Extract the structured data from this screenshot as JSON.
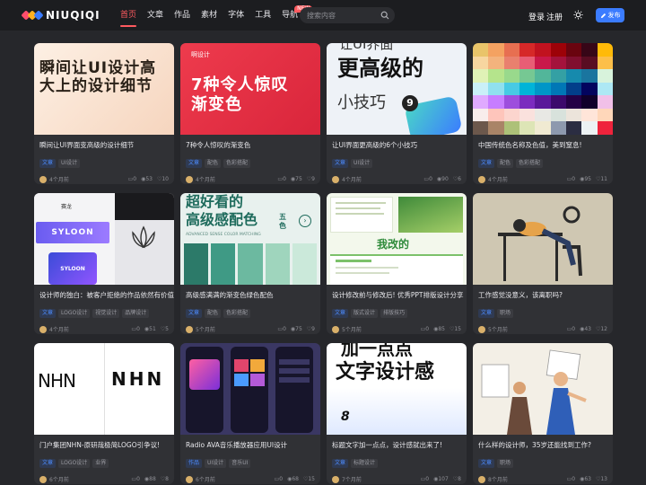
{
  "header": {
    "logo_text": "NIUQIQI",
    "nav": [
      {
        "label": "首页",
        "active": true
      },
      {
        "label": "文章"
      },
      {
        "label": "作品"
      },
      {
        "label": "素材"
      },
      {
        "label": "字体"
      },
      {
        "label": "工具"
      },
      {
        "label": "导航",
        "badge": "NEW"
      }
    ],
    "search_placeholder": "搜索内容",
    "login": "登录",
    "register": "注册",
    "publish": "发布"
  },
  "colors": {
    "accent": "#ff5a5f",
    "primary_button": "#3b7cff",
    "background": "#26272b",
    "card": "#303135"
  },
  "cards": [
    {
      "title": "瞬间让UI界面变高级的设计细节",
      "category": "文章",
      "tags": [
        "UI设计"
      ],
      "time": "4个月前",
      "comments": "0",
      "views": "53",
      "likes": "10",
      "thumb_text": "瞬间让UI设计高大上的设计细节"
    },
    {
      "title": "7种令人惊叹的渐变色",
      "category": "文章",
      "tags": [
        "配色",
        "色彩搭配"
      ],
      "time": "4个月前",
      "comments": "0",
      "views": "75",
      "likes": "9",
      "thumb_brand": "啊设计",
      "thumb_text": "7种令人惊叹渐变色"
    },
    {
      "title": "让UI界面更高级的6个小技巧",
      "category": "文章",
      "tags": [
        "UI设计"
      ],
      "time": "4个月前",
      "comments": "0",
      "views": "90",
      "likes": "6",
      "thumb_top": "让UI界面",
      "thumb_big": "更高级的",
      "thumb_small": "小技巧",
      "thumb_num": "9"
    },
    {
      "title": "中国传统色名称及色值，美到窒息!",
      "category": "文章",
      "tags": [
        "配色",
        "色彩搭配"
      ],
      "time": "4个月前",
      "comments": "0",
      "views": "95",
      "likes": "11"
    },
    {
      "title": "设计师的独白：被客户拒绝的作品依然有价值",
      "category": "文章",
      "tags": [
        "LOGO设计",
        "视觉设计",
        "品牌设计"
      ],
      "time": "4个月前",
      "comments": "0",
      "views": "51",
      "likes": "5",
      "thumb_label": "赛龙",
      "thumb_brand": "SYLOON"
    },
    {
      "title": "高级感满满的渐变色绿色配色",
      "category": "文章",
      "tags": [
        "配色",
        "色彩搭配"
      ],
      "time": "5个月前",
      "comments": "0",
      "views": "75",
      "likes": "9",
      "thumb_line1": "超好看的",
      "thumb_line2": "高级感配色",
      "thumb_side": "五色",
      "thumb_sub": "ADVANCED SENSE COLOR MATCHING"
    },
    {
      "title": "设计修改前与修改后! 优秀PPT排版设计分享",
      "category": "文章",
      "tags": [
        "版式设计",
        "排版技巧"
      ],
      "time": "5个月前",
      "comments": "0",
      "views": "85",
      "likes": "15",
      "thumb_label": "我改的"
    },
    {
      "title": "工作感觉没意义，该离职吗?",
      "category": "文章",
      "tags": [
        "职场"
      ],
      "time": "5个月前",
      "comments": "0",
      "views": "43",
      "likes": "12"
    },
    {
      "title": "门户集团NHN-原研哉极简LOGO引争议!",
      "category": "文章",
      "tags": [
        "LOGO设计",
        "业界"
      ],
      "time": "6个月前",
      "comments": "0",
      "views": "88",
      "likes": "8",
      "thumb_logo": "NHN"
    },
    {
      "title": "Radio AVA音乐播放器应用UI设计",
      "category": "作品",
      "tags": [
        "UI设计",
        "音乐UI"
      ],
      "time": "6个月前",
      "comments": "0",
      "views": "68",
      "likes": "15"
    },
    {
      "title": "标题文字加一点点，设计感就出来了!",
      "category": "文章",
      "tags": [
        "标题设计"
      ],
      "time": "7个月前",
      "comments": "0",
      "views": "107",
      "likes": "8",
      "thumb_line1": "加一点点",
      "thumb_line2": "文字设计感",
      "thumb_num": "8"
    },
    {
      "title": "什么样的设计师，35岁还能找到工作?",
      "category": "文章",
      "tags": [
        "职场"
      ],
      "time": "8个月前",
      "comments": "0",
      "views": "63",
      "likes": "13"
    }
  ]
}
